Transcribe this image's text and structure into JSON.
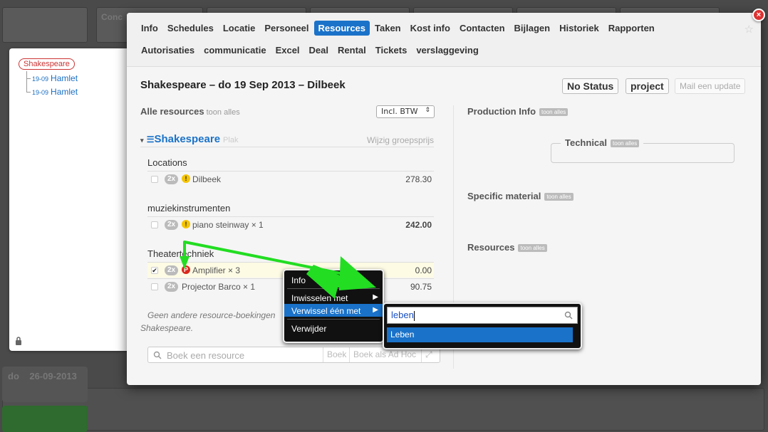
{
  "background": {
    "bottom_rows": [
      {
        "day": "do",
        "date": "26-09-2013"
      }
    ],
    "top_cell_label": "Conc"
  },
  "tree": {
    "root": "Shakespeare",
    "children": [
      {
        "date": "19-09",
        "label": "Hamlet"
      },
      {
        "date": "19-09",
        "label": "Hamlet"
      }
    ]
  },
  "modal": {
    "tabs_row1": [
      "Info",
      "Schedules",
      "Locatie",
      "Personeel",
      "Resources",
      "Taken",
      "Kost info",
      "Contacten",
      "Bijlagen",
      "Historiek",
      "Rapporten"
    ],
    "tabs_row2": [
      "Autorisaties",
      "communicatie",
      "Excel",
      "Deal",
      "Rental",
      "Tickets",
      "verslaggeving"
    ],
    "active_tab": "Resources",
    "close_symbol": "×",
    "star_symbol": "☆",
    "title": "Shakespeare – do 19 Sep 2013 – Dilbeek",
    "status_button": "No Status",
    "project_button": "project",
    "mail_button": "Mail een update",
    "left": {
      "heading": "Alle resources",
      "heading_small": "toon alles",
      "vat_select": "Incl. BTW",
      "group": {
        "name": "Shakespeare",
        "plak": "Plak",
        "edit": "Wijzig groepsprijs"
      },
      "categories": [
        {
          "name": "Locations",
          "rows": [
            {
              "badge": "2x",
              "warn": "yellow",
              "name": "Dilbeek",
              "price": "278.30",
              "bold": false,
              "checked": false
            }
          ]
        },
        {
          "name": "muziekinstrumenten",
          "rows": [
            {
              "badge": "2x",
              "warn": "yellow",
              "name": "piano steinway × 1",
              "price": "242.00",
              "bold": true,
              "checked": false
            }
          ]
        },
        {
          "name": "Theatertechniek",
          "rows": [
            {
              "badge": "2x",
              "warn": "red",
              "name": "Amplifier × 3",
              "price": "0.00",
              "bold": false,
              "checked": true
            },
            {
              "badge": "2x",
              "warn": "",
              "name": "Projector Barco × 1",
              "price": "90.75",
              "bold": false,
              "checked": false
            }
          ]
        }
      ],
      "note_line1": "Geen andere resource-boekingen",
      "note_line2": "Shakespeare.",
      "search_placeholder": "Boek een resource",
      "book_button": "Boek",
      "book_adhoc_button": "Boek als Ad Hoc"
    },
    "right": {
      "production_info": "Production Info",
      "technical": "Technical",
      "specific_material": "Specific material",
      "resources": "Resources",
      "pill": "toon alles"
    }
  },
  "context_menu": {
    "items": [
      "Info",
      "Inwisselen met",
      "Verwissel één met",
      "Verwijder"
    ],
    "highlighted": "Verwissel één met"
  },
  "submenu": {
    "query": "leben",
    "result": "Leben"
  },
  "colors": {
    "accent": "#1a72c9",
    "annotation_arrow": "#22dd22"
  }
}
